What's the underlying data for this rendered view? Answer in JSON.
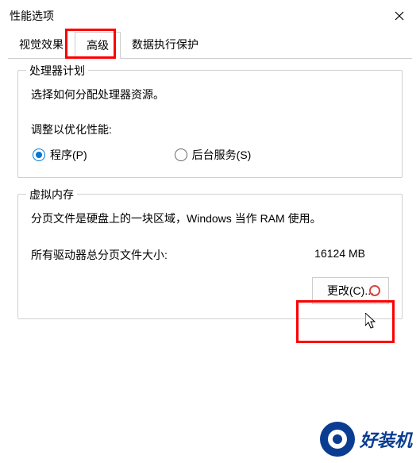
{
  "window": {
    "title": "性能选项"
  },
  "tabs": {
    "visual": "视觉效果",
    "advanced": "高级",
    "dep": "数据执行保护"
  },
  "processor": {
    "groupTitle": "处理器计划",
    "desc": "选择如何分配处理器资源。",
    "adjustLabel": "调整以优化性能:",
    "programs": "程序(P)",
    "background": "后台服务(S)"
  },
  "virtualMemory": {
    "groupTitle": "虚拟内存",
    "desc": "分页文件是硬盘上的一块区域，Windows 当作 RAM 使用。",
    "totalLabel": "所有驱动器总分页文件大小:",
    "totalValue": "16124 MB",
    "changeBtn": "更改(C)..."
  },
  "watermark": {
    "text": "好装机"
  }
}
